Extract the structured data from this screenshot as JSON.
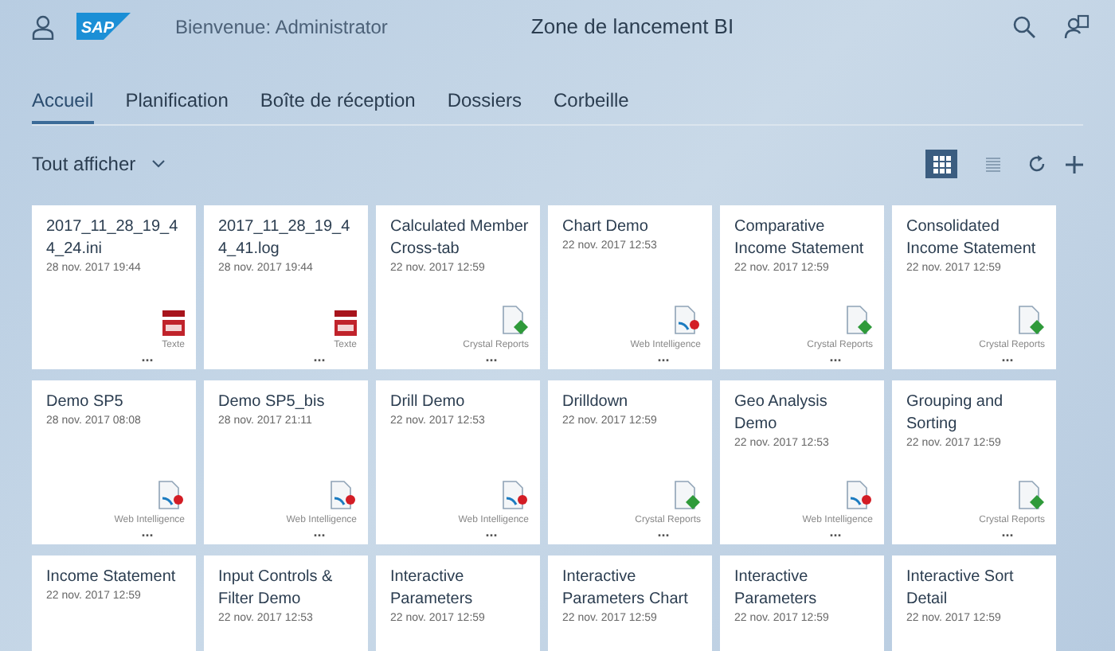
{
  "header": {
    "logo": "SAP",
    "welcome": "Bienvenue: Administrator",
    "title": "Zone de lancement BI"
  },
  "tabs": [
    {
      "label": "Accueil",
      "selected": true
    },
    {
      "label": "Planification",
      "selected": false
    },
    {
      "label": "Boîte de réception",
      "selected": false
    },
    {
      "label": "Dossiers",
      "selected": false
    },
    {
      "label": "Corbeille",
      "selected": false
    }
  ],
  "filter": {
    "label": "Tout afficher"
  },
  "views": [
    {
      "kind": "grid",
      "selected": true
    },
    {
      "kind": "list",
      "selected": false
    }
  ],
  "tiles": [
    {
      "title": "2017_11_28_19_44_24.ini",
      "date": "28 nov. 2017 19:44",
      "kind": "text",
      "type_label": "Texte",
      "more": "..."
    },
    {
      "title": "2017_11_28_19_44_41.log",
      "date": "28 nov. 2017 19:44",
      "kind": "text",
      "type_label": "Texte",
      "more": "..."
    },
    {
      "title": "Calculated Member Cross-tab",
      "date": "22 nov. 2017 12:59",
      "kind": "crystal",
      "type_label": "Crystal Reports",
      "more": "..."
    },
    {
      "title": "Chart Demo",
      "date": "22 nov. 2017 12:53",
      "kind": "webi",
      "type_label": "Web Intelligence",
      "more": "..."
    },
    {
      "title": "Comparative Income Statement",
      "date": "22 nov. 2017 12:59",
      "kind": "crystal",
      "type_label": "Crystal Reports",
      "more": "..."
    },
    {
      "title": "Consolidated Income Statement",
      "date": "22 nov. 2017 12:59",
      "kind": "crystal",
      "type_label": "Crystal Reports",
      "more": "..."
    },
    {
      "title": "Demo SP5",
      "date": "28 nov. 2017 08:08",
      "kind": "webi",
      "type_label": "Web Intelligence",
      "more": "..."
    },
    {
      "title": "Demo SP5_bis",
      "date": "28 nov. 2017 21:11",
      "kind": "webi",
      "type_label": "Web Intelligence",
      "more": "..."
    },
    {
      "title": "Drill Demo",
      "date": "22 nov. 2017 12:53",
      "kind": "webi",
      "type_label": "Web Intelligence",
      "more": "..."
    },
    {
      "title": "Drilldown",
      "date": "22 nov. 2017 12:59",
      "kind": "crystal",
      "type_label": "Crystal Reports",
      "more": "..."
    },
    {
      "title": "Geo Analysis Demo",
      "date": "22 nov. 2017 12:53",
      "kind": "webi",
      "type_label": "Web Intelligence",
      "more": "..."
    },
    {
      "title": "Grouping and Sorting",
      "date": "22 nov. 2017 12:59",
      "kind": "crystal",
      "type_label": "Crystal Reports",
      "more": "..."
    },
    {
      "title": "Income Statement",
      "date": "22 nov. 2017 12:59"
    },
    {
      "title": "Input Controls & Filter Demo",
      "date": "22 nov. 2017 12:53"
    },
    {
      "title": "Interactive Parameters",
      "date": "22 nov. 2017 12:59"
    },
    {
      "title": "Interactive Parameters Chart",
      "date": "22 nov. 2017 12:59"
    },
    {
      "title": "Interactive Parameters",
      "date": "22 nov. 2017 12:59"
    },
    {
      "title": "Interactive Sort Detail",
      "date": "22 nov. 2017 12:59"
    }
  ]
}
